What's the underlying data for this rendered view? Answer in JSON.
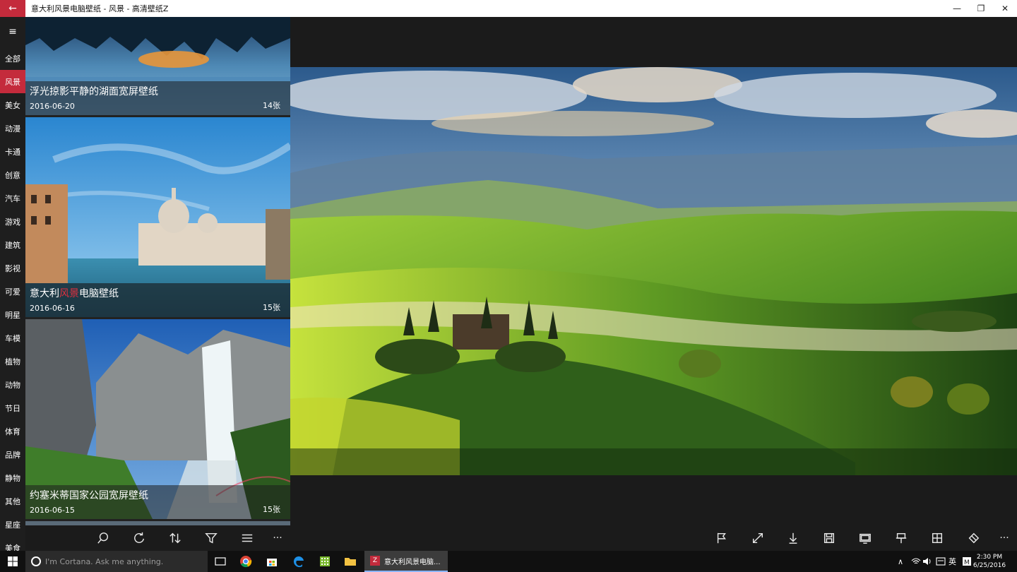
{
  "window": {
    "title": "意大利风景电脑壁纸 - 风景 - 高清壁纸Z",
    "back_icon": "←",
    "minimize": "—",
    "restore": "❐",
    "close": "✕"
  },
  "sidebar": {
    "menu_icon": "≡",
    "items": [
      "全部",
      "风景",
      "美女",
      "动漫",
      "卡通",
      "创意",
      "汽车",
      "游戏",
      "建筑",
      "影视",
      "可爱",
      "明星",
      "车模",
      "植物",
      "动物",
      "节日",
      "体育",
      "品牌",
      "静物",
      "其他",
      "星座",
      "美食"
    ],
    "active_index": 1
  },
  "cards": [
    {
      "title": "浮光掠影平静的湖面宽屏壁纸",
      "date": "2016-06-20",
      "count": "14张"
    },
    {
      "title": "意大利风景电脑壁纸",
      "title_plain": "意大利",
      "title_highlight": "风景",
      "title_rest": "电脑壁纸",
      "date": "2016-06-16",
      "count": "15张"
    },
    {
      "title": "约塞米蒂国家公园宽屏壁纸",
      "date": "2016-06-15",
      "count": "15张"
    }
  ],
  "toolbar": {
    "left": [
      "search-icon",
      "refresh-icon",
      "sort-icon",
      "filter-icon",
      "list-icon",
      "more-icon"
    ],
    "right": [
      "flag-icon",
      "fullscreen-icon",
      "download-icon",
      "save-icon",
      "set-wallpaper-icon",
      "pin-icon",
      "tiles-icon",
      "clear-icon",
      "more-icon"
    ],
    "more": "···"
  },
  "taskbar": {
    "cortana_placeholder": "I'm Cortana. Ask me anything.",
    "active_app_label": "意大利风景电脑...",
    "app_badge": "Z",
    "ime": "英",
    "time": "2:30 PM",
    "date": "6/25/2016"
  },
  "colors": {
    "accent": "#c42b3c",
    "bg": "#1b1b1b"
  }
}
